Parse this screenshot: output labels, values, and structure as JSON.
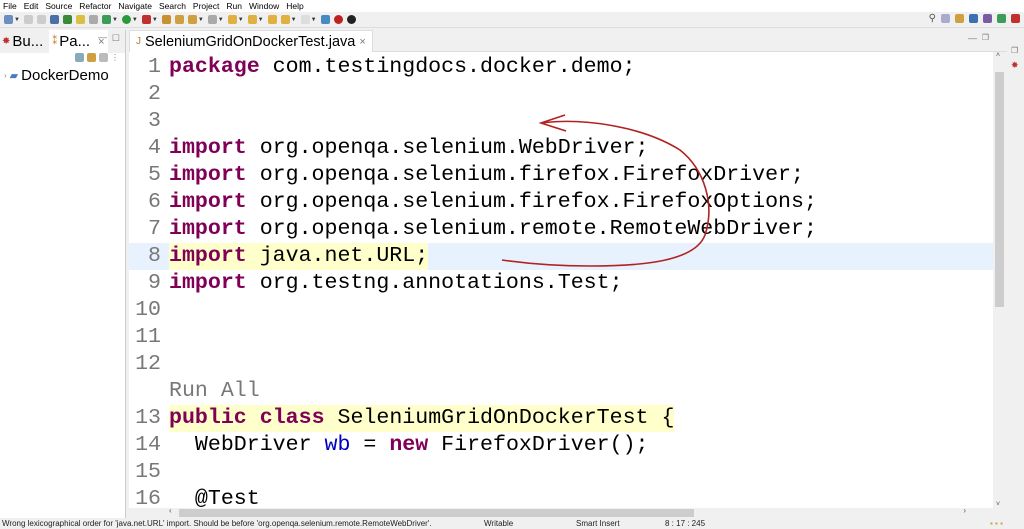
{
  "menu": [
    "File",
    "Edit",
    "Source",
    "Refactor",
    "Navigate",
    "Search",
    "Project",
    "Run",
    "Window",
    "Help"
  ],
  "left_tabs": [
    {
      "label": "Bu..."
    },
    {
      "label": "Pa..."
    }
  ],
  "tree": {
    "project": "DockerDemo"
  },
  "editor": {
    "tab_title": "SeleniumGridOnDockerTest.java",
    "lines": [
      {
        "n": "1",
        "kw": "package",
        "rest": " com.testingdocs.docker.demo;"
      },
      {
        "n": "2"
      },
      {
        "n": "3"
      },
      {
        "n": "4",
        "kw": "import",
        "rest": " org.openqa.selenium.WebDriver;"
      },
      {
        "n": "5",
        "kw": "import",
        "rest": " org.openqa.selenium.firefox.FirefoxDriver;"
      },
      {
        "n": "6",
        "kw": "import",
        "rest": " org.openqa.selenium.firefox.FirefoxOptions;"
      },
      {
        "n": "7",
        "kw": "import",
        "rest": " org.openqa.selenium.remote.RemoteWebDriver;"
      },
      {
        "n": "8",
        "kw": "import",
        "rest": " java.net.URL;"
      },
      {
        "n": "9",
        "kw": "import",
        "rest": " org.testng.annotations.Test;"
      },
      {
        "n": "10"
      },
      {
        "n": "11"
      },
      {
        "n": "12"
      }
    ],
    "code_lens": "Run All",
    "line13": {
      "n": "13",
      "kw1": "public",
      "kw2": "class",
      "rest": " SeleniumGridOnDockerTest {"
    },
    "line14": {
      "n": "14",
      "t1": "  WebDriver ",
      "field": "wb",
      "t2": " = ",
      "kw": "new",
      "t3": " FirefoxDriver();"
    },
    "line15": {
      "n": "15"
    },
    "line16": {
      "n": "16",
      "rest": "  @Test"
    }
  },
  "status": {
    "message": "Wrong lexicographical order for 'java.net.URL' import. Should be before 'org.openqa.selenium.remote.RemoteWebDriver'.",
    "writable": "Writable",
    "insert_mode": "Smart Insert",
    "position": "8 : 17 : 245"
  },
  "colors": {
    "keyword": "#7f0055",
    "field": "#0000c0",
    "current_line": "#e8f2fe",
    "annotation_pen": "#b22222"
  }
}
